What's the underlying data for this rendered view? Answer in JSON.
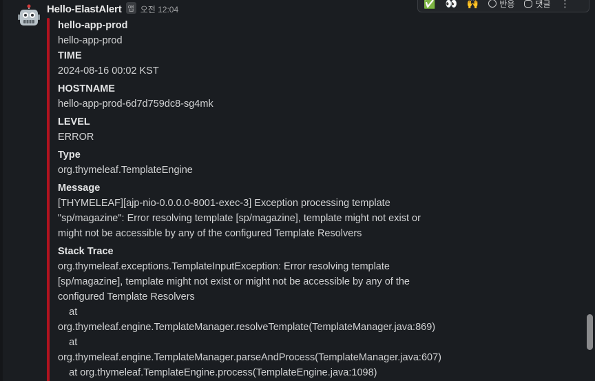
{
  "message": {
    "sender": "Hello-ElastAlert",
    "app_badge": "앱",
    "timestamp": "오전 12:04"
  },
  "toolbar": {
    "items": [
      {
        "icon": "white-check-mark-emoji",
        "glyph": "✅",
        "label": ""
      },
      {
        "icon": "eyes-emoji",
        "glyph": "👀",
        "label": ""
      },
      {
        "icon": "raised-hands-emoji",
        "glyph": "🙌",
        "label": ""
      },
      {
        "icon": "add-reaction-icon",
        "label": "반응"
      },
      {
        "icon": "reply-thread-icon",
        "label": "댓글"
      },
      {
        "icon": "more-actions-icon",
        "glyph": "⋮",
        "label": ""
      }
    ]
  },
  "attachment": {
    "accent_color": "#b1131f",
    "fields": [
      {
        "title": "hello-app-prod",
        "value": "hello-app-prod"
      },
      {
        "title": "TIME",
        "value": "2024-08-16 00:02 KST"
      },
      {
        "title": "HOSTNAME",
        "value": "hello-app-prod-6d7d759dc8-sg4mk"
      },
      {
        "title": "LEVEL",
        "value": "ERROR"
      },
      {
        "title": "Type",
        "value": "org.thymeleaf.TemplateEngine"
      },
      {
        "title": "Message",
        "value": "[THYMELEAF][ajp-nio-0.0.0.0-8001-exec-3] Exception processing template\n\"sp/magazine\": Error resolving template [sp/magazine], template might not exist or\nmight not be accessible by any of the configured Template Resolvers"
      },
      {
        "title": "Stack Trace",
        "value": "org.thymeleaf.exceptions.TemplateInputException: Error resolving template\n[sp/magazine], template might not exist or might not be accessible by any of the\nconfigured Template Resolvers\n    at\norg.thymeleaf.engine.TemplateManager.resolveTemplate(TemplateManager.java:869)\n    at\norg.thymeleaf.engine.TemplateManager.parseAndProcess(TemplateManager.java:607)\n    at org.thymeleaf.TemplateEngine.process(TemplateEngine.java:1098)"
      }
    ]
  }
}
